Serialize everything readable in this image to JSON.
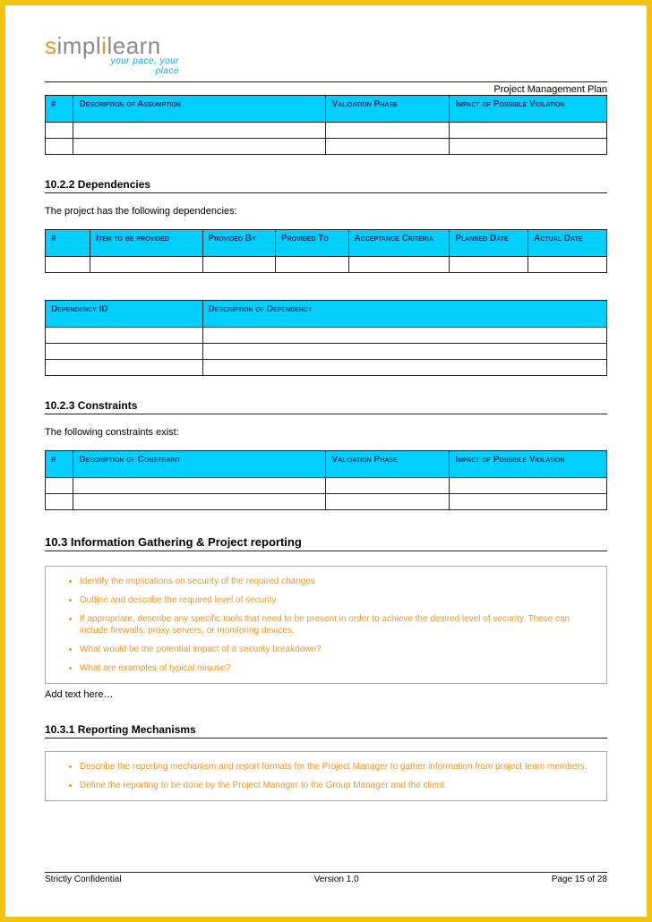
{
  "header": {
    "logo_text": "simplilearn",
    "tagline": "your pace, your place",
    "doc_title": "Project Management Plan"
  },
  "table_assumptions": {
    "headers": [
      "#",
      "Description of Assumption",
      "Validation Phase",
      "Impact of Possible Violation"
    ]
  },
  "section_1022": {
    "title": "10.2.2  Dependencies",
    "intro": "The project has the following dependencies:"
  },
  "table_deps1": {
    "headers": [
      "#",
      "Item to be provided",
      "Provided By",
      "Provided To",
      "Acceptance Criteria",
      "Planned Date",
      "Actual Date"
    ]
  },
  "table_deps2": {
    "headers": [
      "Dependency ID",
      "Description of Dependency"
    ]
  },
  "section_1023": {
    "title": "10.2.3  Constraints",
    "intro": "The following constraints exist:"
  },
  "table_constraints": {
    "headers": [
      "#",
      "Description of Constraint",
      "Validation Phase",
      "Impact of Possible Violation"
    ]
  },
  "section_103": {
    "title": "10.3  Information Gathering & Project reporting"
  },
  "guidance_103": [
    "Identify the implications on security of the required changes",
    "Outline and describe the required level of security",
    "If appropriate, describe any specific tools that need to be present in order to achieve the desired level of security. These can include firewalls, proxy servers, or monitoring devices.",
    "What would be the potential impact of a security breakdown?",
    "What are examples of typical misuse?"
  ],
  "placeholder_103": "Add text here…",
  "section_1031": {
    "title": "10.3.1  Reporting Mechanisms"
  },
  "guidance_1031": [
    "Describe the reporting mechanism and report formats for the Project Manager to gather information from project team members.",
    "Define the reporting to be done by the Project Manager to the Group Manager and the client."
  ],
  "footer": {
    "left": "Strictly Confidential",
    "center": "Version 1.0",
    "right": "Page 15 of 28"
  }
}
